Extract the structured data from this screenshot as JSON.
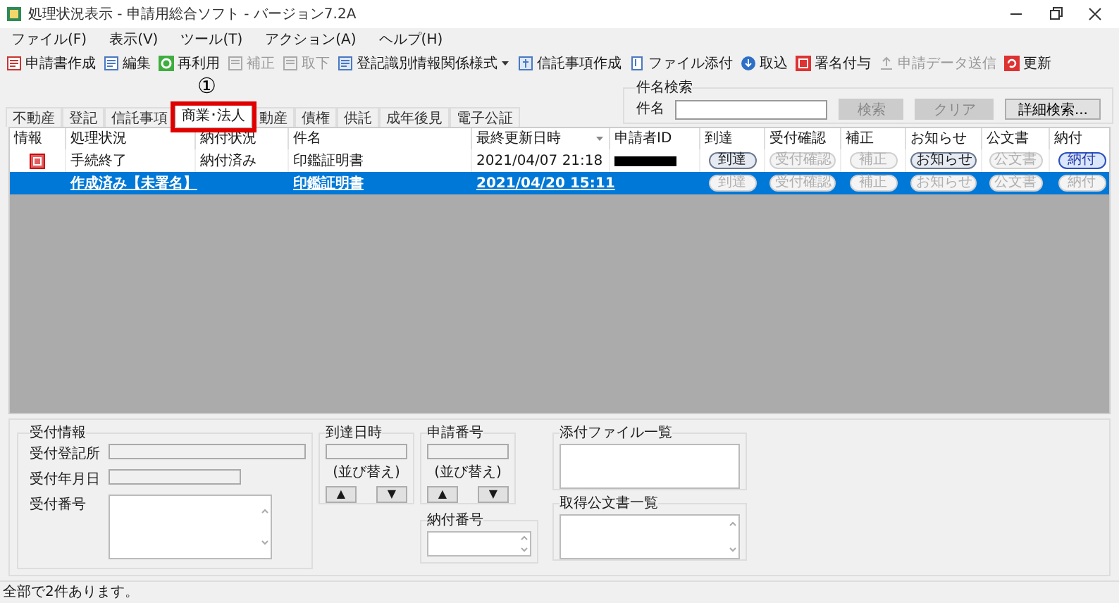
{
  "window": {
    "title": "処理状況表示 - 申請用総合ソフト - バージョン7.2A"
  },
  "menu": [
    "ファイル(F)",
    "表示(V)",
    "ツール(T)",
    "アクション(A)",
    "ヘルプ(H)"
  ],
  "toolbar": [
    {
      "label": "申請書作成",
      "disabled": false,
      "kind": "button"
    },
    {
      "label": "編集",
      "disabled": false,
      "kind": "button"
    },
    {
      "label": "再利用",
      "disabled": false,
      "kind": "button"
    },
    {
      "label": "補正",
      "disabled": true,
      "kind": "button"
    },
    {
      "label": "取下",
      "disabled": true,
      "kind": "button"
    },
    {
      "label": "登記識別情報関係様式",
      "disabled": false,
      "kind": "dropdown"
    },
    {
      "label": "信託事項作成",
      "disabled": false,
      "kind": "button"
    },
    {
      "label": "ファイル添付",
      "disabled": false,
      "kind": "button"
    },
    {
      "label": "取込",
      "disabled": false,
      "kind": "button"
    },
    {
      "label": "署名付与",
      "disabled": false,
      "kind": "button"
    },
    {
      "label": "申請データ送信",
      "disabled": true,
      "kind": "button"
    },
    {
      "label": "更新",
      "disabled": false,
      "kind": "button"
    }
  ],
  "search": {
    "title": "件名検索",
    "label": "件名",
    "buttons": [
      {
        "label": "検索",
        "disabled": true
      },
      {
        "label": "クリア",
        "disabled": true
      },
      {
        "label": "詳細検索...",
        "disabled": false
      }
    ]
  },
  "annotation": {
    "label": "①"
  },
  "tabs": [
    {
      "label": "不動産",
      "selected": false
    },
    {
      "label": "登記",
      "selected": false
    },
    {
      "label": "信託事項",
      "selected": false
    },
    {
      "label": "商業･法人",
      "selected": true
    },
    {
      "label": "動産",
      "selected": false
    },
    {
      "label": "債権",
      "selected": false
    },
    {
      "label": "供託",
      "selected": false
    },
    {
      "label": "成年後見",
      "selected": false
    },
    {
      "label": "電子公証",
      "selected": false
    }
  ],
  "table": {
    "columns": [
      {
        "label": "情報",
        "sorted": false
      },
      {
        "label": "処理状況",
        "sorted": false
      },
      {
        "label": "納付状況",
        "sorted": false
      },
      {
        "label": "件名",
        "sorted": false
      },
      {
        "label": "最終更新日時",
        "sorted": true
      },
      {
        "label": "申請者ID",
        "sorted": false
      },
      {
        "label": "到達",
        "sorted": false
      },
      {
        "label": "受付確認",
        "sorted": false
      },
      {
        "label": "補正",
        "sorted": false
      },
      {
        "label": "お知らせ",
        "sorted": false
      },
      {
        "label": "公文書",
        "sorted": false
      },
      {
        "label": "納付",
        "sorted": false
      }
    ],
    "rows": [
      {
        "selected": false,
        "flag": true,
        "status": "手続終了",
        "payment": "納付済み",
        "subject": "印鑑証明書",
        "updated": "2021/04/07 21:18",
        "applicant_redacted": true,
        "buttons": [
          {
            "label": "到達",
            "disabled": false,
            "highlighted": false
          },
          {
            "label": "受付確認",
            "disabled": true,
            "highlighted": false
          },
          {
            "label": "補正",
            "disabled": true,
            "highlighted": false
          },
          {
            "label": "お知らせ",
            "disabled": false,
            "highlighted": false
          },
          {
            "label": "公文書",
            "disabled": true,
            "highlighted": false
          },
          {
            "label": "納付",
            "disabled": false,
            "highlighted": true
          }
        ]
      },
      {
        "selected": true,
        "flag": false,
        "status": "作成済み【未署名】",
        "payment": "",
        "subject": "印鑑証明書",
        "updated": "2021/04/20 15:11",
        "applicant_redacted": false,
        "buttons": [
          {
            "label": "到達",
            "disabled": true,
            "highlighted": false
          },
          {
            "label": "受付確認",
            "disabled": true,
            "highlighted": false
          },
          {
            "label": "補正",
            "disabled": true,
            "highlighted": false
          },
          {
            "label": "お知らせ",
            "disabled": true,
            "highlighted": false
          },
          {
            "label": "公文書",
            "disabled": true,
            "highlighted": false
          },
          {
            "label": "納付",
            "disabled": true,
            "highlighted": false
          }
        ]
      }
    ]
  },
  "details": {
    "reception": {
      "title": "受付情報",
      "fields": [
        "受付登記所",
        "受付年月日",
        "受付番号"
      ]
    },
    "arrival": {
      "title": "到達日時",
      "sort_label": "(並び替え)",
      "up": "▲",
      "down": "▼"
    },
    "application_no": {
      "title": "申請番号",
      "sort_label": "(並び替え)",
      "up": "▲",
      "down": "▼"
    },
    "payment_no": {
      "title": "納付番号"
    },
    "attachments": {
      "title": "添付ファイル一覧"
    },
    "documents": {
      "title": "取得公文書一覧"
    }
  },
  "status_bar": "全部で2件あります。"
}
